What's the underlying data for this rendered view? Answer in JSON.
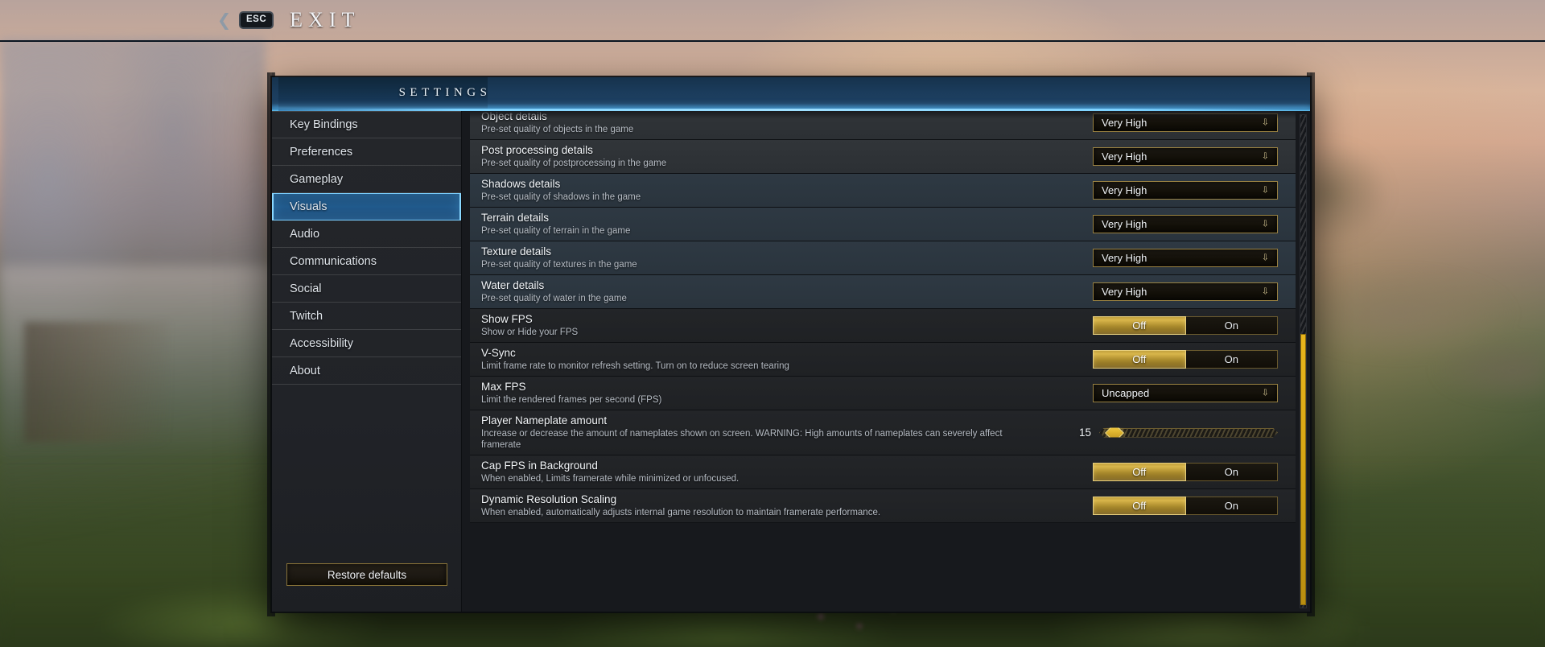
{
  "topbar": {
    "back_chevron": "chevron-left-icon",
    "esc_key": "ESC",
    "exit_label": "EXIT"
  },
  "panel": {
    "title": "SETTINGS"
  },
  "sidebar": {
    "items": [
      {
        "label": "Key Bindings",
        "selected": false
      },
      {
        "label": "Preferences",
        "selected": false
      },
      {
        "label": "Gameplay",
        "selected": false
      },
      {
        "label": "Visuals",
        "selected": true
      },
      {
        "label": "Audio",
        "selected": false
      },
      {
        "label": "Communications",
        "selected": false
      },
      {
        "label": "Social",
        "selected": false
      },
      {
        "label": "Twitch",
        "selected": false
      },
      {
        "label": "Accessibility",
        "selected": false
      },
      {
        "label": "About",
        "selected": false
      }
    ],
    "restore_defaults_label": "Restore defaults"
  },
  "settings": {
    "rows": [
      {
        "label": "Object details",
        "desc": "Pre-set quality of objects in the game",
        "control": "dropdown",
        "value": "Very High"
      },
      {
        "label": "Post processing details",
        "desc": "Pre-set quality of postprocessing in the game",
        "control": "dropdown",
        "value": "Very High"
      },
      {
        "label": "Shadows details",
        "desc": "Pre-set quality of shadows in the game",
        "control": "dropdown",
        "value": "Very High"
      },
      {
        "label": "Terrain details",
        "desc": "Pre-set quality of terrain in the game",
        "control": "dropdown",
        "value": "Very High"
      },
      {
        "label": "Texture details",
        "desc": "Pre-set quality of textures in the game",
        "control": "dropdown",
        "value": "Very High"
      },
      {
        "label": "Water details",
        "desc": "Pre-set quality of water in the game",
        "control": "dropdown",
        "value": "Very High"
      },
      {
        "label": "Show FPS",
        "desc": "Show or Hide your FPS",
        "control": "toggle",
        "off_label": "Off",
        "on_label": "On",
        "value": "Off"
      },
      {
        "label": "V-Sync",
        "desc": "Limit frame rate to monitor refresh setting. Turn on to reduce screen tearing",
        "control": "toggle",
        "off_label": "Off",
        "on_label": "On",
        "value": "Off"
      },
      {
        "label": "Max FPS",
        "desc": "Limit the rendered frames per second (FPS)",
        "control": "dropdown",
        "value": "Uncapped"
      },
      {
        "label": "Player Nameplate amount",
        "desc": "Increase or decrease the amount of nameplates shown on screen. WARNING: High amounts of nameplates can severely affect framerate",
        "control": "slider",
        "value": "15",
        "percent": 8
      },
      {
        "label": "Cap FPS in Background",
        "desc": "When enabled, Limits framerate while minimized or unfocused.",
        "control": "toggle",
        "off_label": "Off",
        "on_label": "On",
        "value": "Off"
      },
      {
        "label": "Dynamic Resolution Scaling",
        "desc": "When enabled, automatically adjusts internal game resolution to maintain framerate performance.",
        "control": "toggle",
        "off_label": "Off",
        "on_label": "On",
        "value": "Off"
      }
    ]
  },
  "colors": {
    "accent_gold": "#d8b54a",
    "accent_blue": "#7ccfff",
    "scrollbar_thumb": "#d9a815",
    "panel_bg": "#17191d"
  }
}
